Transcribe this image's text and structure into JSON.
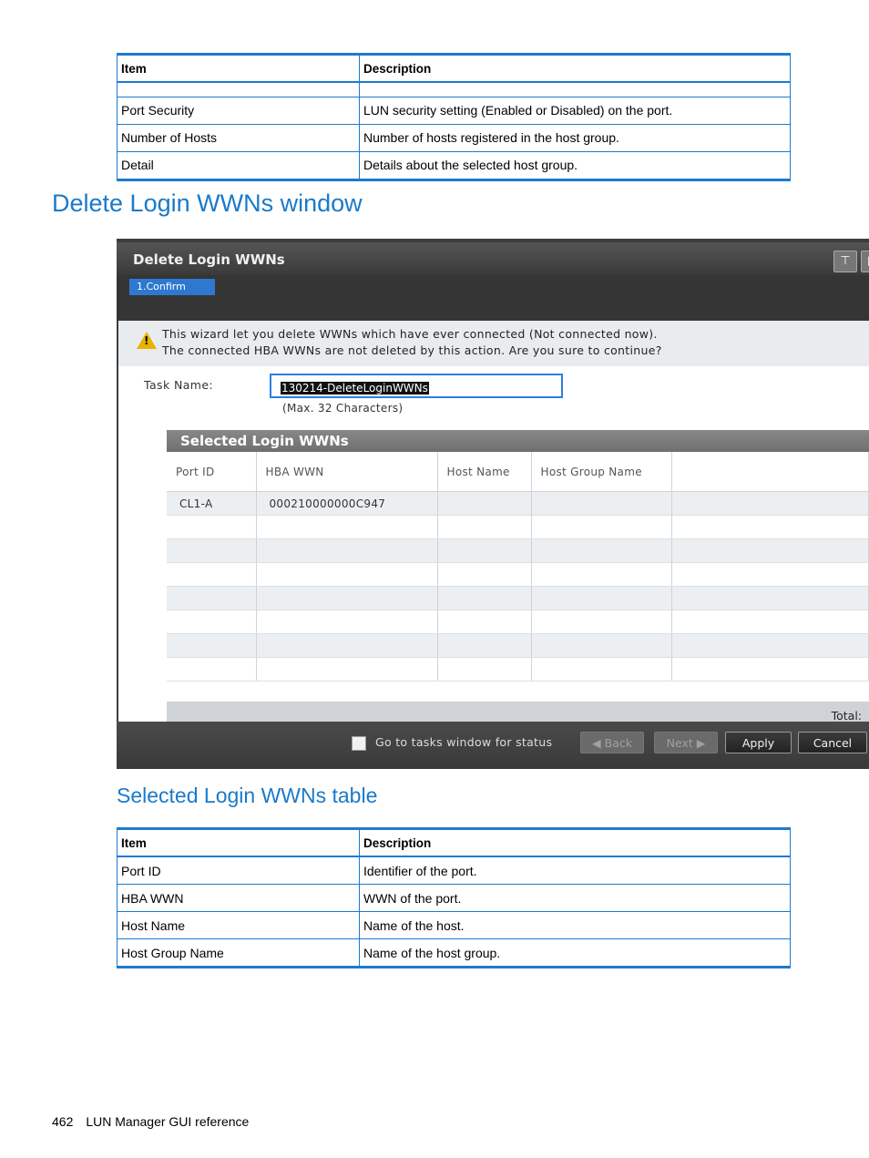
{
  "top_table": {
    "headers": [
      "Item",
      "Description"
    ],
    "rows": [
      [
        "",
        ""
      ],
      [
        "Port Security",
        "LUN security setting (Enabled or Disabled) on the port."
      ],
      [
        "Number of Hosts",
        "Number of hosts registered in the host group."
      ],
      [
        "Detail",
        "Details about the selected host group."
      ]
    ]
  },
  "section_title": "Delete Login WWNs window",
  "screenshot": {
    "window_title": "Delete Login WWNs",
    "step_label": "1.Confirm",
    "warning_line1": "This wizard let you delete WWNs which have ever connected (Not connected now).",
    "warning_line2": "The connected HBA WWNs are not deleted by this action.  Are you sure to continue?",
    "task_name_label": "Task Name:",
    "task_name_value": "130214-DeleteLoginWWNs",
    "task_name_hint": "(Max. 32 Characters)",
    "panel_title": "Selected Login WWNs",
    "columns": [
      "Port ID",
      "HBA WWN",
      "Host Name",
      "Host Group Name",
      ""
    ],
    "rows": [
      [
        "CL1-A",
        "000210000000C947",
        "",
        "",
        ""
      ]
    ],
    "total_label": "Total:",
    "checkbox_label": "Go to tasks window for status",
    "buttons": {
      "back": "Back",
      "next": "Next",
      "apply": "Apply",
      "cancel": "Cancel"
    }
  },
  "subsection_title": "Selected Login WWNs table",
  "bottom_table": {
    "headers": [
      "Item",
      "Description"
    ],
    "rows": [
      [
        "Port ID",
        "Identifier of the port."
      ],
      [
        "HBA WWN",
        "WWN of the port."
      ],
      [
        "Host Name",
        "Name of the host."
      ],
      [
        "Host Group Name",
        "Name of the host group."
      ]
    ]
  },
  "footer": {
    "page_number": "462",
    "running_title": "LUN Manager GUI reference"
  },
  "colors": {
    "heading_blue": "#1a7ac9",
    "table_rule_blue": "#1e7ad1"
  }
}
